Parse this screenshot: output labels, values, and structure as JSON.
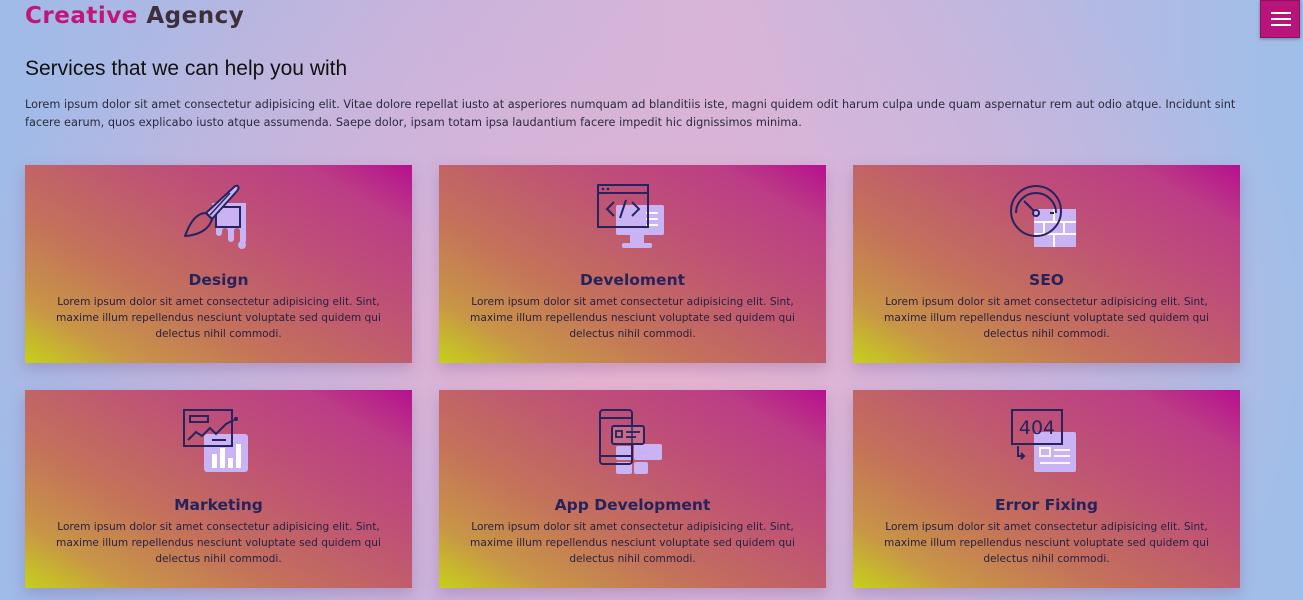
{
  "header": {
    "logo_word1": "Creative",
    "logo_word2": "Agency",
    "menu_icon": "hamburger-menu-icon"
  },
  "section": {
    "title": "Services that we can help you with",
    "intro": "Lorem ipsum dolor sit amet consectetur adipisicing elit. Vitae dolore repellat iusto at asperiores numquam ad blanditiis iste, magni quidem odit harum culpa unde quam aspernatur rem aut odio atque. Incidunt sint facere earum, quos explicabo iusto atque assumenda. Saepe dolor, ipsam totam ipsa laudantium facere impedit hic dignissimos minima."
  },
  "services": [
    {
      "title": "Design",
      "icon": "paint-brush-icon",
      "text": "Lorem ipsum dolor sit amet consectetur adipisicing elit. Sint, maxime illum repellendus nesciunt voluptate sed quidem qui delectus nihil commodi."
    },
    {
      "title": "Develoment",
      "icon": "code-monitor-icon",
      "text": "Lorem ipsum dolor sit amet consectetur adipisicing elit. Sint, maxime illum repellendus nesciunt voluptate sed quidem qui delectus nihil commodi."
    },
    {
      "title": "SEO",
      "icon": "speedometer-icon",
      "text": "Lorem ipsum dolor sit amet consectetur adipisicing elit. Sint, maxime illum repellendus nesciunt voluptate sed quidem qui delectus nihil commodi."
    },
    {
      "title": "Marketing",
      "icon": "analytics-chart-icon",
      "text": "Lorem ipsum dolor sit amet consectetur adipisicing elit. Sint, maxime illum repellendus nesciunt voluptate sed quidem qui delectus nihil commodi."
    },
    {
      "title": "App Development",
      "icon": "mobile-app-icon",
      "text": "Lorem ipsum dolor sit amet consectetur adipisicing elit. Sint, maxime illum repellendus nesciunt voluptate sed quidem qui delectus nihil commodi."
    },
    {
      "title": "Error Fixing",
      "icon": "error-404-icon",
      "text": "Lorem ipsum dolor sit amet consectetur adipisicing elit. Sint, maxime illum repellendus nesciunt voluptate sed quidem qui delectus nihil commodi."
    }
  ],
  "error_icon_text": "404",
  "colors": {
    "accent": "#b8147a",
    "title_text": "#24235c",
    "icon_stroke": "#26245e",
    "icon_fill": "#c9b3f5"
  }
}
